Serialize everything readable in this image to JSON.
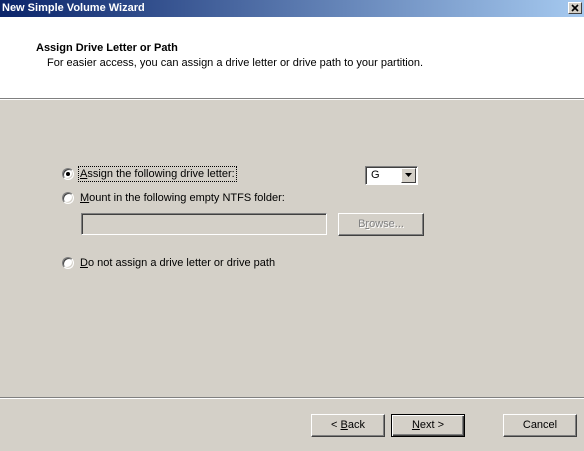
{
  "window": {
    "title": "New Simple Volume Wizard",
    "close_glyph": "✕"
  },
  "header": {
    "title": "Assign Drive Letter or Path",
    "subtitle": "For easier access, you can assign a drive letter or drive path to your partition."
  },
  "options": {
    "assign_letter": {
      "label_prefix": "",
      "hotkey": "A",
      "label_rest": "ssign the following drive letter:",
      "selected": true
    },
    "mount_folder": {
      "label_prefix": "",
      "hotkey": "M",
      "label_rest": "ount in the following empty NTFS folder:",
      "selected": false
    },
    "no_letter": {
      "label_prefix": "",
      "hotkey": "D",
      "label_rest": "o not assign a drive letter or drive path",
      "selected": false
    }
  },
  "drive_letter": {
    "value": "G"
  },
  "folder_path": {
    "value": "",
    "placeholder": ""
  },
  "browse": {
    "prefix": "B",
    "hotkey": "r",
    "rest": "owse..."
  },
  "footer": {
    "back": {
      "prefix": "< ",
      "hotkey": "B",
      "rest": "ack"
    },
    "next": {
      "prefix": "",
      "hotkey": "N",
      "rest": "ext >"
    },
    "cancel": {
      "label": "Cancel"
    }
  },
  "colors": {
    "titlebar_start": "#0a246a",
    "titlebar_end": "#a6caf0",
    "dialog_bg": "#d4d0c8",
    "header_bg": "#ffffff"
  },
  "icons": {
    "close": "close-icon",
    "dropdown": "chevron-down-icon"
  }
}
